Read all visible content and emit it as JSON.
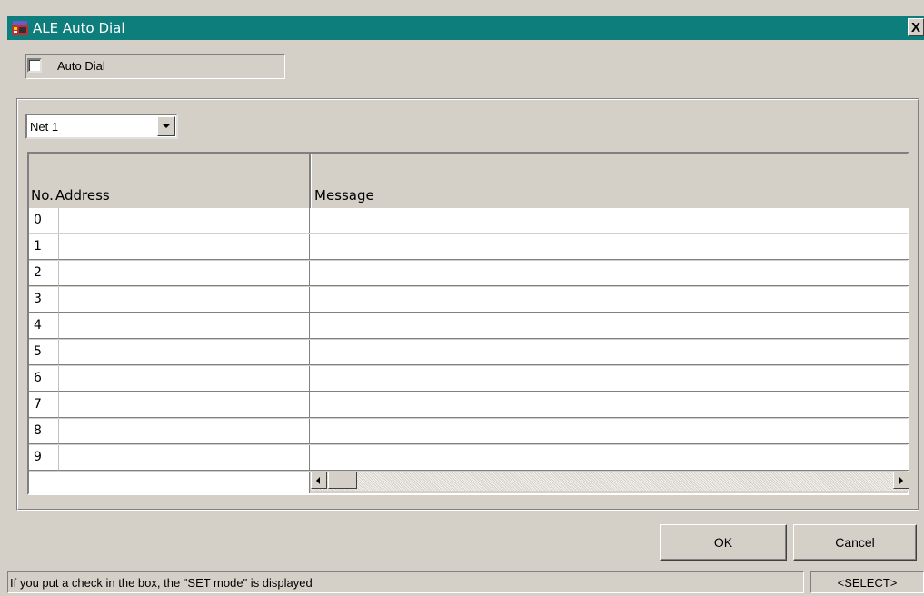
{
  "window": {
    "title": "ALE Auto Dial",
    "close_label": "X",
    "title_bar_color": "#0d7e7c",
    "app_icon": "radio-icon"
  },
  "auto_dial": {
    "label": "Auto Dial",
    "checked": false
  },
  "net_select": {
    "value": "Net 1"
  },
  "grid": {
    "columns": [
      "No.",
      "Address",
      "Message"
    ],
    "rows": [
      {
        "no": "0",
        "address": "",
        "message": ""
      },
      {
        "no": "1",
        "address": "",
        "message": ""
      },
      {
        "no": "2",
        "address": "",
        "message": ""
      },
      {
        "no": "3",
        "address": "",
        "message": ""
      },
      {
        "no": "4",
        "address": "",
        "message": ""
      },
      {
        "no": "5",
        "address": "",
        "message": ""
      },
      {
        "no": "6",
        "address": "",
        "message": ""
      },
      {
        "no": "7",
        "address": "",
        "message": ""
      },
      {
        "no": "8",
        "address": "",
        "message": ""
      },
      {
        "no": "9",
        "address": "",
        "message": ""
      }
    ]
  },
  "buttons": {
    "ok": "OK",
    "cancel": "Cancel"
  },
  "status": {
    "message": "If you put a check in the box, the \"SET mode\" is displayed",
    "mode": "<SELECT>"
  }
}
